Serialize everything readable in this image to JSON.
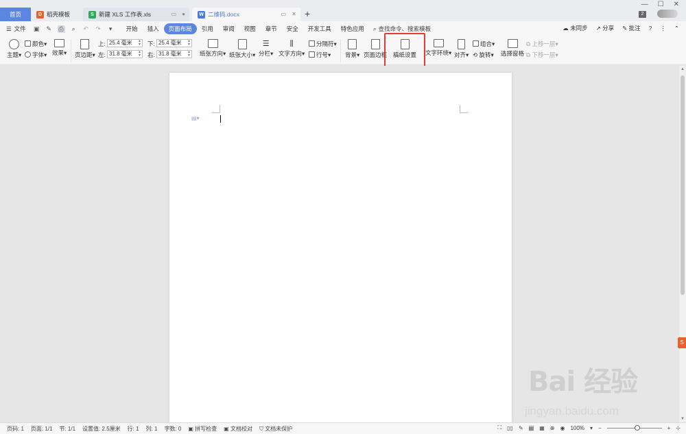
{
  "tabs": {
    "home": "首页",
    "tab1": "稻壳模板",
    "tab2": "新建 XLS 工作表.xls",
    "tab3": "二维码.docx",
    "new_tab": "+",
    "badge_count": "2"
  },
  "menu": {
    "file": "文件",
    "tabs": [
      "开始",
      "插入",
      "页面布局",
      "引用",
      "审阅",
      "视图",
      "章节",
      "安全",
      "开发工具",
      "特色应用"
    ],
    "active_tab": "页面布局",
    "search": "查找命令、搜索模板",
    "sync": "未同步",
    "share": "分享",
    "comment": "批注"
  },
  "ribbon": {
    "theme": "主题",
    "color": "颜色",
    "font": "字体",
    "effect": "效果",
    "margins": "页边距",
    "top_label": "上:",
    "top_value": "25.4 毫米",
    "bottom_label": "下:",
    "bottom_value": "25.4 毫米",
    "left_label": "左:",
    "left_value": "31.8 毫米",
    "right_label": "右:",
    "right_value": "31.8 毫米",
    "orientation": "纸张方向",
    "size": "纸张大小",
    "columns": "分栏",
    "text_direction": "文字方向",
    "breaks": "分隔符",
    "line_numbers": "行号",
    "background": "背景",
    "page_border": "页面边框",
    "manuscript": "稿纸设置",
    "text_wrap": "文字环绕",
    "align": "对齐",
    "group": "组合",
    "rotate": "旋转",
    "selection_pane": "选择窗格",
    "bring_forward": "上移一层",
    "send_backward": "下移一层"
  },
  "status": {
    "page_code": "页码: 1",
    "pages": "页面: 1/1",
    "section": "节: 1/1",
    "setting": "设置值: 2.5厘米",
    "row": "行: 1",
    "col": "列: 1",
    "words": "字数: 0",
    "spell_check": "拼写检查",
    "doc_proof": "文档校对",
    "doc_protect": "文档未保护",
    "zoom": "100%"
  },
  "watermark": {
    "main": "Bai 经验",
    "url": "jingyan.baidu.com"
  },
  "colors": {
    "accent": "#5b87e3",
    "highlight": "#e53935"
  }
}
